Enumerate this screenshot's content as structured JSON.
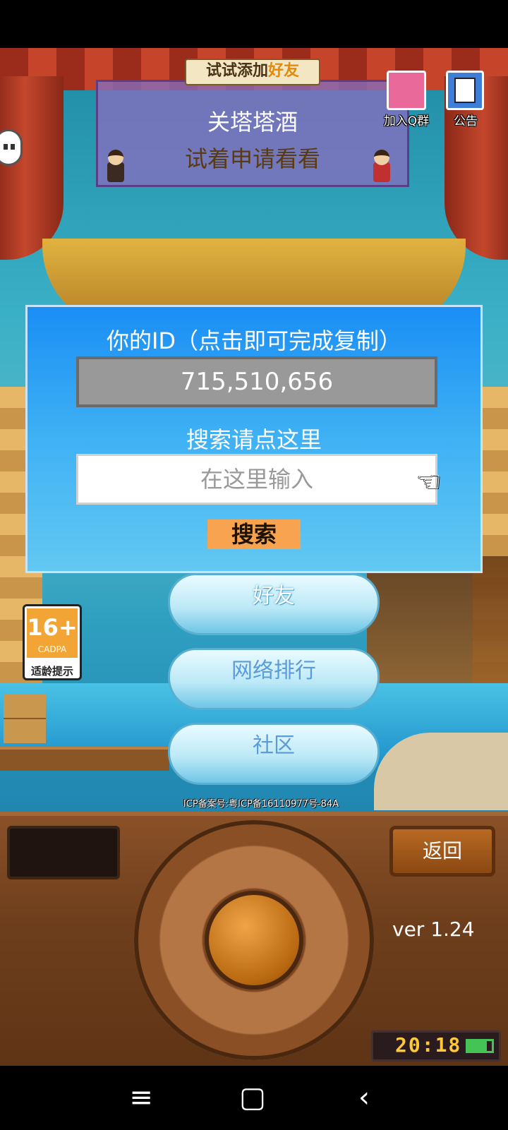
{
  "banner": {
    "tag_prefix": "试试添加",
    "tag_highlight": "好友",
    "title": "关塔塔酒",
    "message": "试着申请看看"
  },
  "top_icons": {
    "qgroup_label": "加入Q群",
    "notice_label": "公告"
  },
  "dialog": {
    "title": "你的ID（点击即可完成复制）",
    "id_value": "715,510,656",
    "search_hint": "搜索请点这里",
    "search_placeholder": "在这里输入",
    "search_button": "搜索"
  },
  "menu": {
    "friends": "好友",
    "ranking": "网络排行",
    "community": "社区"
  },
  "age_rating": {
    "number": "16+",
    "org": "CADPA",
    "label": "适龄提示"
  },
  "icp": "ICP备案号:粤ICP备16110977号-84A",
  "console": {
    "back_button": "返回",
    "version": "ver 1.24",
    "clock": "20:18"
  },
  "nav": {
    "menu": "≡",
    "home": "▢",
    "back": "‹"
  },
  "colors": {
    "dialog_top": "#1a8ef5",
    "dialog_bottom": "#62c8f2",
    "search_button": "#f7a350",
    "id_box": "#999999",
    "wood": "#6f3f1c"
  }
}
